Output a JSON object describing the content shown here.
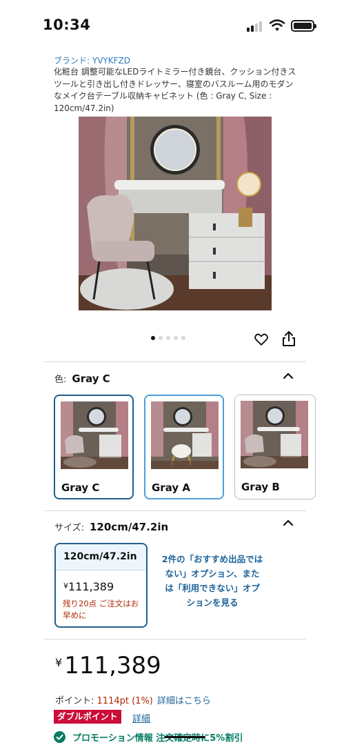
{
  "status_bar": {
    "time": "10:34"
  },
  "product": {
    "brand": "ブランド: YVYKFZD",
    "title": "化粧台 調整可能なLEDライトミラー付き鏡台、クッション付きスツールと引き出し付きドレッサー、寝室のバスルーム用のモダンなメイク台テーブル収納キャビネット (色 : Gray C, Size : 120cm/47.2in)",
    "image_count": 5,
    "active_image_index": 0
  },
  "color_section": {
    "label": "色:",
    "selected": "Gray C",
    "swatches": [
      {
        "label": "Gray C",
        "state": "selected"
      },
      {
        "label": "Gray A",
        "state": "hovered"
      },
      {
        "label": "Gray B",
        "state": "normal"
      }
    ]
  },
  "size_section": {
    "label": "サイズ:",
    "selected": "120cm/47.2in",
    "card": {
      "size": "120cm/47.2in",
      "yen": "¥",
      "price": "111,389",
      "stock": "残り20点 ご注文はお早めに"
    },
    "other_options": "2件の「おすすめ出品ではない」オプション、または「利用できない」オプションを見る"
  },
  "pricing": {
    "yen": "¥",
    "price": "111,389",
    "points_label": "ポイント:",
    "points_value": "1114pt (1%)",
    "points_link": "詳細はこちら",
    "badge": "ダブルポイント",
    "badge_link": "詳細",
    "promo": "プロモーション情報 注文確定時に5%割引"
  },
  "colors": {
    "link": "#1d6399",
    "brand_link": "#2a7bc0",
    "price_red": "#b12704",
    "badge_red": "#cc0c39",
    "promo_green": "#067d62",
    "selected_border": "#1f5f8e"
  }
}
